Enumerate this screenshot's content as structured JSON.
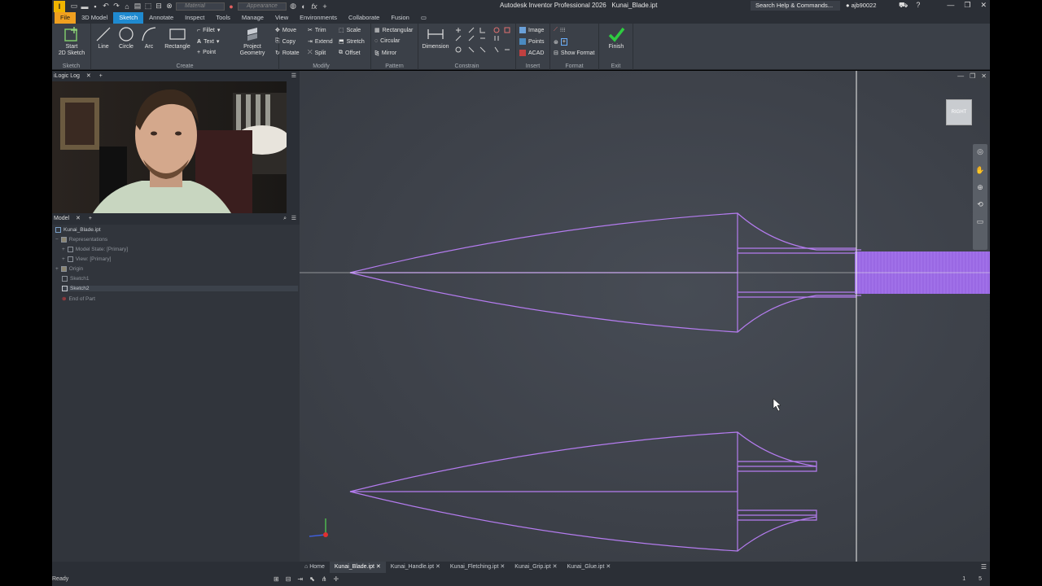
{
  "title": {
    "app_name": "Autodesk Inventor Professional 2026",
    "doc_name": "Kunai_Blade.ipt",
    "material_placeholder": "Material",
    "appearance_placeholder": "Appearance",
    "search_label": "Search Help & Commands...",
    "user": "ajb90022"
  },
  "menu": {
    "file": "File",
    "tabs": [
      "3D Model",
      "Sketch",
      "Annotate",
      "Inspect",
      "Tools",
      "Manage",
      "View",
      "Environments",
      "Collaborate",
      "Fusion"
    ],
    "active": "Sketch"
  },
  "ribbon": {
    "sketch": {
      "start_line1": "Start",
      "start_line2": "2D Sketch",
      "label": "Sketch"
    },
    "create": {
      "line": "Line",
      "circle": "Circle",
      "arc": "Arc",
      "rectangle": "Rectangle",
      "fillet": "Fillet",
      "text": "Text",
      "point": "Point",
      "label": "Create"
    },
    "project": {
      "line1": "Project",
      "line2": "Geometry"
    },
    "modify": {
      "move": "Move",
      "trim": "Trim",
      "scale": "Scale",
      "copy": "Copy",
      "extend": "Extend",
      "stretch": "Stretch",
      "rotate": "Rotate",
      "split": "Split",
      "offset": "Offset",
      "label": "Modify"
    },
    "pattern": {
      "rectangular": "Rectangular",
      "circular": "Circular",
      "mirror": "Mirror",
      "label": "Pattern"
    },
    "constrain": {
      "dimension": "Dimension",
      "label": "Constrain"
    },
    "insert": {
      "image": "Image",
      "points": "Points",
      "acad": "ACAD",
      "label": "Insert"
    },
    "format": {
      "show_format": "Show Format",
      "label": "Format"
    },
    "exit": {
      "finish": "Finish",
      "label": "Exit"
    }
  },
  "panels": {
    "logic_log": "iLogic Log",
    "model": "Model",
    "tree": [
      {
        "label": "Kunai_Blade.ipt"
      },
      {
        "label": "Representations"
      },
      {
        "label": "Model State: [Primary]"
      },
      {
        "label": "View: [Primary]"
      },
      {
        "label": "Origin"
      },
      {
        "label": "Sketch1"
      },
      {
        "label": "Sketch2"
      },
      {
        "label": "End of Part"
      }
    ]
  },
  "viewport": {
    "viewcube_label": "RIGHT",
    "sketch_color": "#b57cf0"
  },
  "doc_tabs": {
    "home": "Home",
    "tabs": [
      "Kunai_Blade.ipt",
      "Kunai_Handle.ipt",
      "Kunai_Fletching.ipt",
      "Kunai_Grip.ipt",
      "Kunai_Glue.ipt"
    ],
    "active": "Kunai_Blade.ipt"
  },
  "status": {
    "text": "Ready",
    "count1": "1",
    "count2": "5"
  }
}
